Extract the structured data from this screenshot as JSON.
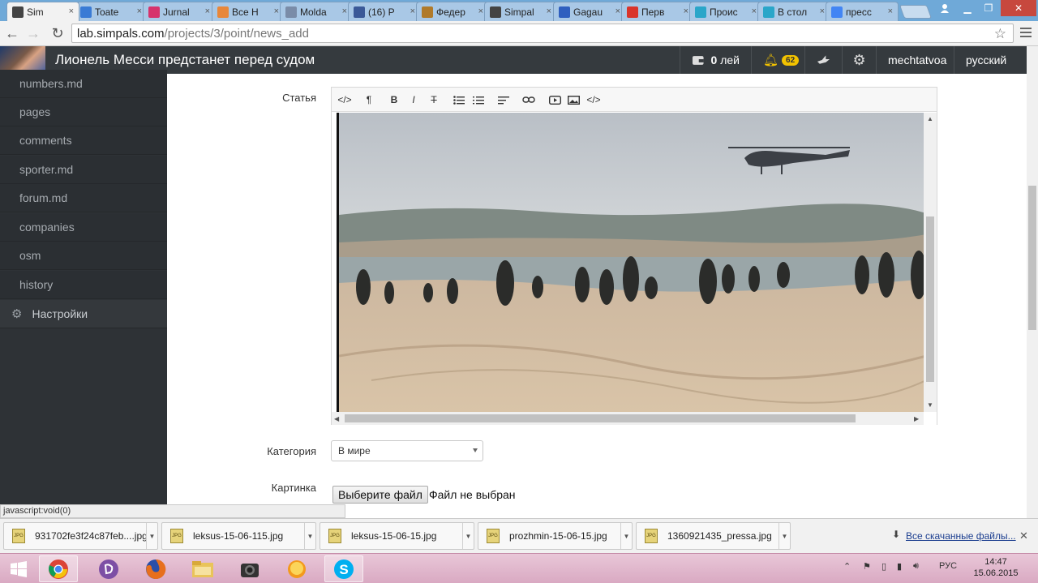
{
  "browser": {
    "tabs": [
      {
        "title": "Sim",
        "icon": "flask-icon",
        "color": "#444444",
        "active": true
      },
      {
        "title": "Toate",
        "icon": "site-icon",
        "color": "#3a7bd5"
      },
      {
        "title": "Jurnal",
        "icon": "site-icon",
        "color": "#d6336c"
      },
      {
        "title": "Все Н",
        "icon": "site-icon",
        "color": "#e8873a"
      },
      {
        "title": "Molda",
        "icon": "site-icon",
        "color": "#7a8ca8"
      },
      {
        "title": "(16) Р",
        "icon": "facebook-icon",
        "color": "#3b5998"
      },
      {
        "title": "Федер",
        "icon": "site-icon",
        "color": "#b07a2a"
      },
      {
        "title": "Simpal",
        "icon": "flask-icon",
        "color": "#444444"
      },
      {
        "title": "Gagau",
        "icon": "site-icon",
        "color": "#2f5fbf"
      },
      {
        "title": "Перв",
        "icon": "site-icon",
        "color": "#d9342b"
      },
      {
        "title": "Проис",
        "icon": "site-icon",
        "color": "#2aa6c9"
      },
      {
        "title": "В стол",
        "icon": "site-icon",
        "color": "#2aa6c9"
      },
      {
        "title": "пресс",
        "icon": "google-icon",
        "color": "#4285f4"
      }
    ],
    "url_host": "lab.simpals.com",
    "url_path": "/projects/3/point/news_add"
  },
  "header": {
    "title": "Лионель Месси предстанет перед судом",
    "wallet_amount": "0",
    "wallet_currency": "лей",
    "notifications_count": "62",
    "username": "mechtatvoa",
    "language": "русский"
  },
  "sidebar": {
    "items": [
      "numbers.md",
      "pages",
      "comments",
      "sporter.md",
      "forum.md",
      "companies",
      "osm",
      "history"
    ],
    "settings_label": "Настройки"
  },
  "form": {
    "article_label": "Статья",
    "category_label": "Категория",
    "category_value": "В мире",
    "picture_label": "Картинка",
    "file_button": "Выберите файл",
    "file_status": "Файл не выбран"
  },
  "editor_toolbar": [
    "</>",
    "¶",
    "B",
    "I",
    "T",
    "bullet-list-icon",
    "numbered-list-icon",
    "align-icon",
    "link-icon",
    "video-icon",
    "image-icon",
    "</>"
  ],
  "status_url": "javascript:void(0)",
  "downloads": {
    "files": [
      "931702fe3f24c87feb....jpg",
      "leksus-15-06-115.jpg",
      "leksus-15-06-15.jpg",
      "prozhmin-15-06-15.jpg",
      "1360921435_pressa.jpg"
    ],
    "show_all": "Все скачанные файлы..."
  },
  "taskbar": {
    "language": "РУС",
    "time": "14:47",
    "date": "15.06.2015"
  }
}
